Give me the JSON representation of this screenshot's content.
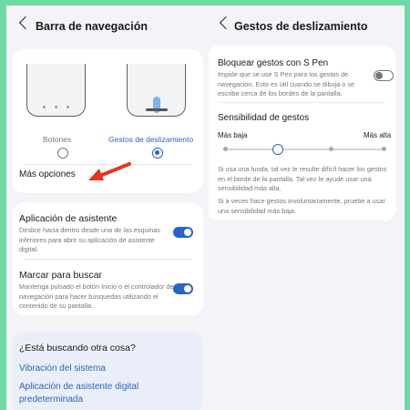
{
  "left": {
    "title": "Barra de navegación",
    "option_buttons": "Botones",
    "option_gestures": "Gestos de deslizamiento",
    "more_options": "Más opciones",
    "assistant_title": "Aplicación de asistente",
    "assistant_desc": "Deslice hacia dentro desde una de las esquinas inferiores para abrir su aplicación de asistente digital.",
    "assistant_on": true,
    "mark_search_title": "Marcar para buscar",
    "mark_search_desc": "Mantenga pulsado el botón Inicio o el controlador de navegación para hacer búsquedas utilizando el contenido de su pantalla.",
    "mark_search_on": true,
    "suggest_title": "¿Está buscando otra cosa?",
    "link_vibration": "Vibración del sistema",
    "link_assistant_1": "Aplicación de asistente digital",
    "link_assistant_2": "predeterminada"
  },
  "right": {
    "title": "Gestos de deslizamiento",
    "block_title": "Bloquear gestos con S Pen",
    "block_desc": "Impide que se use S Pen para los gestos de navegación. Esto es útil cuando se dibuja o se escribe cerca de los bordes de la pantalla.",
    "block_on": false,
    "sensitivity_title": "Sensibilidad de gestos",
    "low_label": "Más baja",
    "high_label": "Más alta",
    "sensitivity_level": 2,
    "sensitivity_steps": 5,
    "note1": "Si usa una funda, tal vez le resulte difícil hacer los gestos en el borde de la pantalla. Tal vez le ayude usar una sensibilidad más alta.",
    "note2": "Si a veces hace gestos involuntariamente, pruebe a usar una sensibilidad más baja."
  },
  "colors": {
    "background": "#6fd9a3",
    "accent": "#2a63c7",
    "annotation_arrow": "#e53520"
  }
}
